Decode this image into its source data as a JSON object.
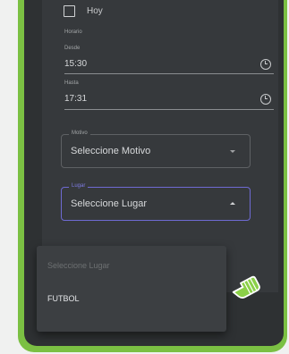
{
  "colors": {
    "frame": "#7bc043",
    "panel": "#2e3133",
    "dialog": "#36393c",
    "focus_accent": "#6e6ad2",
    "button_accent": "#a4552e",
    "cursor_hand": "#8bd048"
  },
  "hoy": {
    "label": "Hoy",
    "checked": false
  },
  "horarios": {
    "title": "Horario",
    "desde": {
      "label": "Desde",
      "value": "15:30",
      "icon": "clock-icon"
    },
    "hasta": {
      "label": "Hasta",
      "value": "17:31",
      "icon": "clock-icon"
    }
  },
  "motivo": {
    "label": "Motivo",
    "value": "Seleccione Motivo",
    "icon": "caret-down-icon"
  },
  "lugar": {
    "label": "Lugar",
    "value": "Seleccione Lugar",
    "icon": "caret-up-icon",
    "options": [
      "Seleccione Lugar",
      "FUTBOL"
    ]
  },
  "cursor": {
    "icon": "pointing-hand-cursor-icon"
  }
}
